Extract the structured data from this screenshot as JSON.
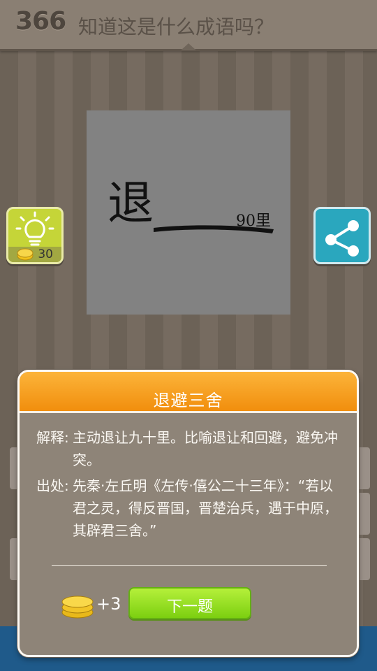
{
  "header": {
    "level": "366",
    "question": "知道这是什么成语吗？"
  },
  "puzzle": {
    "character": "退",
    "note": "90里"
  },
  "hint": {
    "icon": "lightbulb-icon",
    "cost": "30"
  },
  "share": {
    "icon": "share-icon"
  },
  "dialog": {
    "title": "退避三舍",
    "meaning_label": "解释:",
    "meaning": "主动退让九十里。比喻退让和回避，避免冲突。",
    "source_label": "出处:",
    "source": "先秦·左丘明《左传·僖公二十三年》：“若以君之灵，得反晋国，晋楚治兵，遇于中原，其辟君三舍。”",
    "reward": "+3",
    "next_label": "下一题"
  },
  "colors": {
    "header_bg": "#8a7f73",
    "dialog_head": "#f18e0d",
    "next_button": "#7ccf11",
    "hint_button": "#c5d538",
    "share_button": "#2aa7be",
    "bottom_bar": "#1f5a8a"
  }
}
